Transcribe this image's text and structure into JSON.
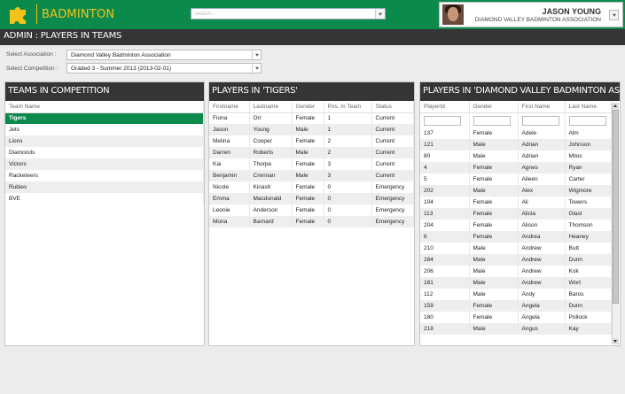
{
  "header": {
    "brand": "BADMINTON",
    "search_placeholder": "Search...",
    "user_name": "JASON YOUNG",
    "user_org": "DIAMOND VALLEY BADMINTON ASSOCIATION"
  },
  "page_title": "ADMIN : PLAYERS IN TEAMS",
  "filters": {
    "association_label": "Select Association :",
    "association_value": "Diamond Valley Badminton Association",
    "competition_label": "Select Competition :",
    "competition_value": "Graded 3 - Summer 2013 (2013-02-01)"
  },
  "teams_panel": {
    "title": "TEAMS IN COMPETITION",
    "column": "Team Name",
    "teams": [
      "Tigers",
      "Jets",
      "Lions",
      "Diamonds",
      "Victors",
      "Racketeers",
      "Rubies",
      "BVE"
    ],
    "selected": "Tigers"
  },
  "players_panel": {
    "title": "PLAYERS IN 'TIGERS'",
    "columns": [
      "Firstname",
      "Lastname",
      "Gender",
      "Pos. In Team",
      "Status"
    ],
    "rows": [
      [
        "Fiona",
        "Orr",
        "Female",
        "1",
        "Current"
      ],
      [
        "Jason",
        "Young",
        "Male",
        "1",
        "Current"
      ],
      [
        "Melina",
        "Cooper",
        "Female",
        "2",
        "Current"
      ],
      [
        "Darren",
        "Roberts",
        "Male",
        "2",
        "Current"
      ],
      [
        "Kai",
        "Thorpe",
        "Female",
        "3",
        "Current"
      ],
      [
        "Benjamin",
        "Crennan",
        "Male",
        "3",
        "Current"
      ],
      [
        "Nicole",
        "Kinash",
        "Female",
        "0",
        "Emergency"
      ],
      [
        "Emma",
        "Macdonald",
        "Female",
        "0",
        "Emergency"
      ],
      [
        "Leonie",
        "Anderson",
        "Female",
        "0",
        "Emergency"
      ],
      [
        "Mona",
        "Barnard",
        "Female",
        "0",
        "Emergency"
      ]
    ]
  },
  "association_panel": {
    "title": "PLAYERS IN 'DIAMOND VALLEY BADMINTON ASSOCIATION'",
    "columns": [
      "PlayerId",
      "Gender",
      "First Name",
      "Last Name"
    ],
    "rows": [
      [
        "137",
        "Female",
        "Adele",
        "Alm"
      ],
      [
        "121",
        "Male",
        "Adrian",
        "Johnson"
      ],
      [
        "80",
        "Male",
        "Adrian",
        "Milos"
      ],
      [
        "4",
        "Female",
        "Agnes",
        "Ryan"
      ],
      [
        "5",
        "Female",
        "Aileen",
        "Carter"
      ],
      [
        "202",
        "Male",
        "Alex",
        "Wigmore"
      ],
      [
        "104",
        "Female",
        "Ali",
        "Towers"
      ],
      [
        "113",
        "Female",
        "Alicia",
        "Glasl"
      ],
      [
        "204",
        "Female",
        "Alison",
        "Thomson"
      ],
      [
        "6",
        "Female",
        "Andrea",
        "Heaney"
      ],
      [
        "210",
        "Male",
        "Andrew",
        "Butt"
      ],
      [
        "284",
        "Male",
        "Andrew",
        "Dunn"
      ],
      [
        "206",
        "Male",
        "Andrew",
        "Kok"
      ],
      [
        "181",
        "Male",
        "Andrew",
        "Wort"
      ],
      [
        "112",
        "Male",
        "Andy",
        "Baros"
      ],
      [
        "159",
        "Female",
        "Angela",
        "Dunn"
      ],
      [
        "180",
        "Female",
        "Angela",
        "Pollock"
      ],
      [
        "218",
        "Male",
        "Angus",
        "Kay"
      ]
    ]
  },
  "colors": {
    "accent": "#0c8a4c",
    "brand": "#f3c21b",
    "dark": "#353535"
  }
}
